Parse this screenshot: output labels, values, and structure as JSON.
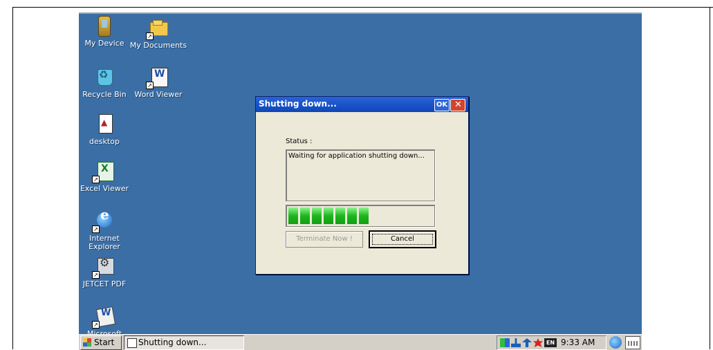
{
  "desktop": {
    "icons": [
      {
        "label": "My Device",
        "icon": "device-icon"
      },
      {
        "label": "My Documents",
        "icon": "folder-icon"
      },
      {
        "label": "Recycle Bin",
        "icon": "recycle-bin-icon"
      },
      {
        "label": "Word Viewer",
        "icon": "word-icon"
      },
      {
        "label": "desktop",
        "icon": "document-icon"
      },
      {
        "label": "Excel Viewer",
        "icon": "excel-icon"
      },
      {
        "label": "Internet Explorer",
        "icon": "internet-explorer-icon"
      },
      {
        "label": "JETCET PDF",
        "icon": "pdf-icon"
      },
      {
        "label": "Microsoft",
        "icon": "wordpad-icon"
      }
    ]
  },
  "dialog": {
    "title": "Shutting down...",
    "ok_label": "OK",
    "status_label": "Status :",
    "status_text": "Waiting for application shutting down...",
    "progress": {
      "filled_segments": 7,
      "fraction": 0.55
    },
    "terminate_label": "Terminate Now !",
    "cancel_label": "Cancel"
  },
  "taskbar": {
    "start_label": "Start",
    "task_label": "Shutting down...",
    "language": "EN",
    "clock": "9:33 AM"
  },
  "colors": {
    "desktop": "#3a6ea5",
    "titlebar": "#0c46b8",
    "progress": "#1eb51e"
  }
}
